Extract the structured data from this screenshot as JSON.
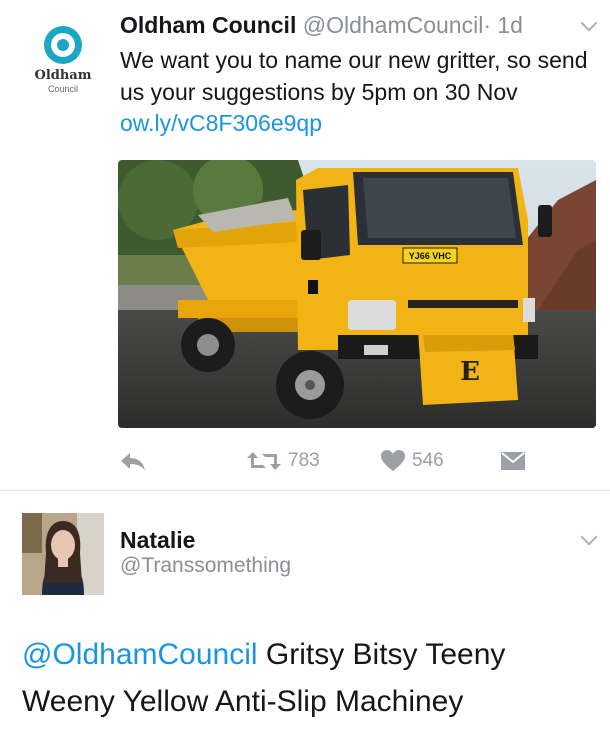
{
  "tweet1": {
    "avatar_text": "Oldham",
    "avatar_subtext": "Council",
    "author_name": "Oldham Council",
    "author_handle": "@OldhamCouncil",
    "time": "· 1d",
    "text": "We want you to name our new gritter, so send us your suggestions by 5pm on 30 Nov ",
    "link": "ow.ly/vC8F306e9qp",
    "photo": {
      "number_plate": "YJ66 VHC",
      "plate_letter": "E"
    },
    "actions": {
      "reply_icon": "reply-icon",
      "retweet_icon": "retweet-icon",
      "retweet_count": "783",
      "like_icon": "heart-icon",
      "like_count": "546",
      "dm_icon": "envelope-icon"
    },
    "colors": {
      "link": "#1b95e0",
      "gritter_yellow": "#f2b414",
      "avatar_accent": "#19a7c3"
    }
  },
  "tweet2": {
    "author_name": "Natalie",
    "author_handle": "@Transsomething",
    "mention": "@OldhamCouncil",
    "text": " Gritsy Bitsy Teeny Weeny Yellow Anti-Slip Machiney"
  }
}
